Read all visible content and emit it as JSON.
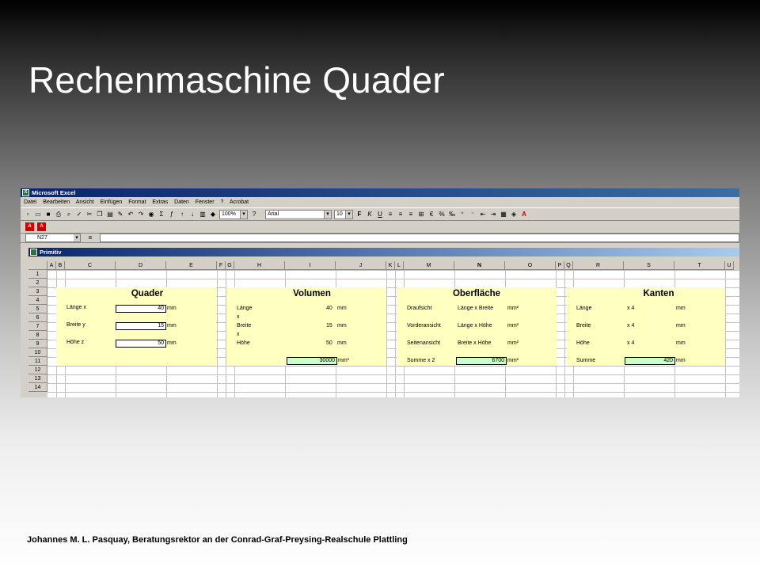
{
  "slide": {
    "title": "Rechenmaschine Quader",
    "footer": "Johannes M. L. Pasquay, Beratungsrektor an der Conrad-Graf-Preysing-Realschule Plattling"
  },
  "excel": {
    "app_title": "Microsoft Excel",
    "menu": [
      "Datei",
      "Bearbeiten",
      "Ansicht",
      "Einfügen",
      "Format",
      "Extras",
      "Daten",
      "Fenster",
      "?",
      "Acrobat"
    ],
    "zoom": "100%",
    "font_name": "Arial",
    "font_size": "10",
    "name_box": "N27",
    "formula_eq": "=",
    "workbook_title": "Primitiv",
    "columns": [
      "A",
      "B",
      "C",
      "D",
      "E",
      "F",
      "G",
      "H",
      "I",
      "J",
      "K",
      "L",
      "M",
      "N",
      "O",
      "P",
      "Q",
      "R",
      "S",
      "T",
      "U"
    ],
    "rows": [
      "1",
      "2",
      "3",
      "4",
      "5",
      "6",
      "7",
      "8",
      "9",
      "10",
      "11",
      "12",
      "13",
      "14"
    ]
  },
  "quader": {
    "heading": "Quader",
    "laenge_label": "Länge x",
    "laenge_value": "40",
    "laenge_unit": "mm",
    "breite_label": "Breite y",
    "breite_value": "15",
    "breite_unit": "mm",
    "hoehe_label": "Höhe z",
    "hoehe_value": "50",
    "hoehe_unit": "mm"
  },
  "volumen": {
    "heading": "Volumen",
    "r5_label": "Länge",
    "r5_value": "40",
    "r5_unit": "mm",
    "r6_label": "x",
    "r7_label": "Breite",
    "r7_value": "15",
    "r7_unit": "mm",
    "r8_label": "x",
    "r9_label": "Höhe",
    "r9_value": "50",
    "r9_unit": "mm",
    "result": "30000",
    "result_unit": "mm³"
  },
  "oberflaeche": {
    "heading": "Oberfläche",
    "r5_label": "Draufsicht",
    "r5_formula": "Länge x Breite",
    "r5_unit": "mm²",
    "r7_label": "Vorderansicht",
    "r7_formula": "Länge x Höhe",
    "r7_unit": "mm²",
    "r9_label": "Seitenansicht",
    "r9_formula": "Breite x Höhe",
    "r9_unit": "mm²",
    "sum_label": "Summe x 2",
    "result": "6700",
    "result_unit": "mm²"
  },
  "kanten": {
    "heading": "Kanten",
    "r5_label": "Länge",
    "r5_formula": "x 4",
    "r5_unit": "mm",
    "r7_label": "Breite",
    "r7_formula": "x 4",
    "r7_unit": "mm",
    "r9_label": "Höhe",
    "r9_formula": "x 4",
    "r9_unit": "mm",
    "sum_label": "Summe",
    "result": "420",
    "result_unit": "mm"
  },
  "colors": {
    "block_fill": "#ffffc0",
    "result_fill": "#ccffcc",
    "titlebar": "#0a246a"
  }
}
